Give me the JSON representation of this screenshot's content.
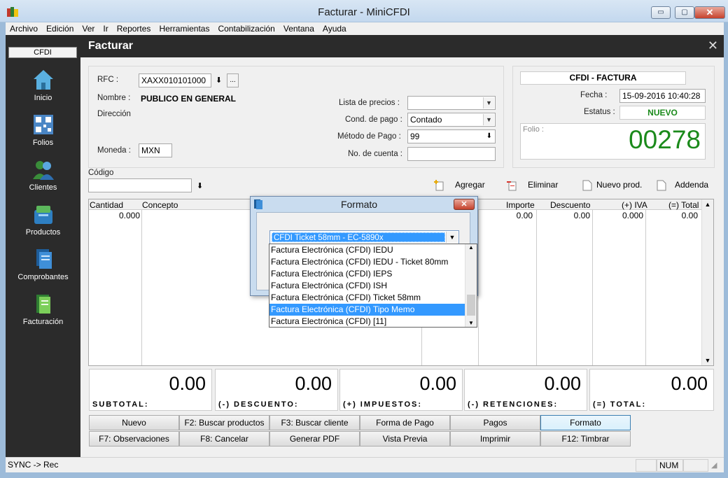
{
  "window": {
    "title": "Facturar - MiniCFDI",
    "min": "▭",
    "max": "▢",
    "close": "✕"
  },
  "menu": [
    "Archivo",
    "Edición",
    "Ver",
    "Ir",
    "Reportes",
    "Herramientas",
    "Contabilización",
    "Ventana",
    "Ayuda"
  ],
  "sidebar": {
    "header": "CFDI",
    "items": [
      {
        "label": "Inicio",
        "icon": "home-icon"
      },
      {
        "label": "Folios",
        "icon": "qr-code-icon"
      },
      {
        "label": "Clientes",
        "icon": "users-icon"
      },
      {
        "label": "Productos",
        "icon": "box-icon"
      },
      {
        "label": "Comprobantes",
        "icon": "documents-icon"
      },
      {
        "label": "Facturación",
        "icon": "invoice-icon"
      }
    ]
  },
  "page": {
    "title": "Facturar",
    "close": "✕"
  },
  "customer": {
    "rfc_label": "RFC :",
    "rfc_value": "XAXX010101000",
    "rfc_more": "...",
    "nombre_label": "Nombre :",
    "nombre_value": "PUBLICO EN GENERAL",
    "direccion_label": "Dirección",
    "moneda_label": "Moneda :",
    "moneda_value": "MXN"
  },
  "payment": {
    "lista_label": "Lista de precios :",
    "lista_value": "",
    "cond_label": "Cond. de pago :",
    "cond_value": "Contado",
    "metodo_label": "Método de Pago :",
    "metodo_value": "99",
    "cuenta_label": "No. de cuenta :",
    "cuenta_value": ""
  },
  "cfdi": {
    "header": "CFDI - FACTURA",
    "fecha_label": "Fecha :",
    "fecha_value": "15-09-2016 10:40:28",
    "estatus_label": "Estatus :",
    "estatus_value": "NUEVO",
    "folio_label": "Folio :",
    "folio_value": "00278",
    "accent": "#1b8a1b"
  },
  "codigo": {
    "label": "Código",
    "value": ""
  },
  "toolbar": {
    "agregar": "Agregar",
    "eliminar": "Eliminar",
    "nuevo_prod": "Nuevo prod.",
    "addenda": "Addenda"
  },
  "grid": {
    "headers": [
      "Cantidad",
      "Concepto",
      "Importe",
      "Descuento",
      "(+) IVA",
      "(=) Total"
    ],
    "row": {
      "cantidad": "0.000",
      "importe": "0.00",
      "descuento": "0.00",
      "iva": "0.000",
      "total": "0.00"
    }
  },
  "totals": [
    {
      "label": "SUBTOTAL:",
      "value": "0.00"
    },
    {
      "label": "(-) DESCUENTO:",
      "value": "0.00"
    },
    {
      "label": "(+) IMPUESTOS:",
      "value": "0.00"
    },
    {
      "label": "(-) RETENCIONES:",
      "value": "0.00"
    },
    {
      "label": "(=) TOTAL:",
      "value": "0.00"
    }
  ],
  "buttons_row1": [
    "Nuevo",
    "F2: Buscar productos",
    "F3: Buscar cliente",
    "Forma de Pago",
    "Pagos",
    "Formato"
  ],
  "buttons_row2": [
    "F7: Observaciones",
    "F8: Cancelar",
    "Generar PDF",
    "Vista Previa",
    "Imprimir",
    "F12:  Timbrar"
  ],
  "status": {
    "sync": "SYNC -> Rec",
    "num": "NUM"
  },
  "modal": {
    "title": "Formato",
    "close": "✕",
    "selected": "CFDI Ticket 58mm - EC-5890x",
    "options": [
      "Factura Electrónica (CFDI) IEDU",
      "Factura Electrónica (CFDI) IEDU - Ticket 80mm",
      "Factura Electrónica (CFDI) IEPS",
      "Factura Electrónica (CFDI) ISH",
      "Factura Electrónica (CFDI) Ticket 58mm",
      "Factura Electrónica (CFDI) Tipo Memo",
      "Factura Electrónica (CFDI) [11]"
    ],
    "highlighted_index": 5
  }
}
